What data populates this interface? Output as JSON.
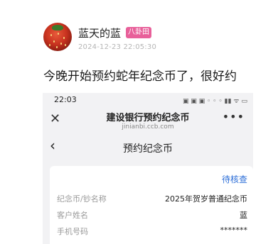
{
  "post": {
    "username": "蓝天的蓝",
    "badge": "八卦田",
    "timestamp": "2024-12-23 22:05:30",
    "text": "今晚开始预约蛇年纪念币了，很好约"
  },
  "screenshot": {
    "status_time": "22:03",
    "status_icons": "▣ ▣ ▣ ◦ ◦ ◦ ▮▮ ᯤ ▭",
    "browser_title": "建设银行预约纪念币",
    "browser_url": "jinianbi.ccb.com",
    "close_glyph": "✕",
    "more_glyph": "•••",
    "back_glyph": "‹",
    "page_title": "预约纪念币",
    "status_label": "待核查",
    "rows": [
      {
        "label": "纪念币/钞名称",
        "value": "2025年贺岁普通纪念币"
      },
      {
        "label": "客户姓名",
        "value": "蓝"
      },
      {
        "label": "手机号码",
        "value": "*******"
      }
    ]
  }
}
